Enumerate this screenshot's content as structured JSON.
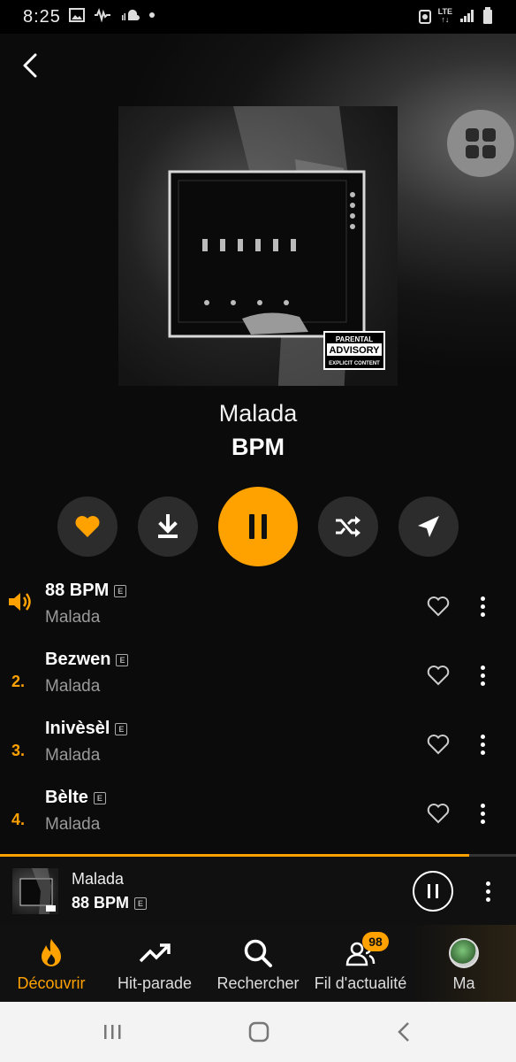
{
  "status_bar": {
    "time": "8:25",
    "network": "LTE"
  },
  "album": {
    "title": "Malada",
    "artist": "BPM"
  },
  "cover": {
    "advisory_text": [
      "PARENTAL",
      "ADVISORY",
      "EXPLICIT CONTENT"
    ]
  },
  "tracks": [
    {
      "number": "",
      "title": "88 BPM",
      "subtitle": "Malada",
      "explicit": "E",
      "playing": true
    },
    {
      "number": "2.",
      "title": "Bezwen",
      "subtitle": "Malada",
      "explicit": "E",
      "playing": false
    },
    {
      "number": "3.",
      "title": "Inivèsèl",
      "subtitle": "Malada",
      "explicit": "E",
      "playing": false
    },
    {
      "number": "4.",
      "title": "Bèlte",
      "subtitle": "Malada",
      "explicit": "E",
      "playing": false
    }
  ],
  "mini_player": {
    "title": "Malada",
    "subtitle": "88 BPM",
    "explicit": "E",
    "progress": 0.91
  },
  "nav": [
    {
      "label": "Découvrir",
      "icon": "flame-icon",
      "active": true
    },
    {
      "label": "Hit-parade",
      "icon": "trending-icon",
      "active": false
    },
    {
      "label": "Rechercher",
      "icon": "search-icon",
      "active": false
    },
    {
      "label": "Fil d'actualité",
      "icon": "people-icon",
      "active": false,
      "badge": "98"
    },
    {
      "label": "Ma",
      "icon": "avatar-icon",
      "active": false
    }
  ],
  "colors": {
    "accent": "#ffa200",
    "background": "#0c0c0c",
    "control_bg": "#2c2c2c"
  }
}
